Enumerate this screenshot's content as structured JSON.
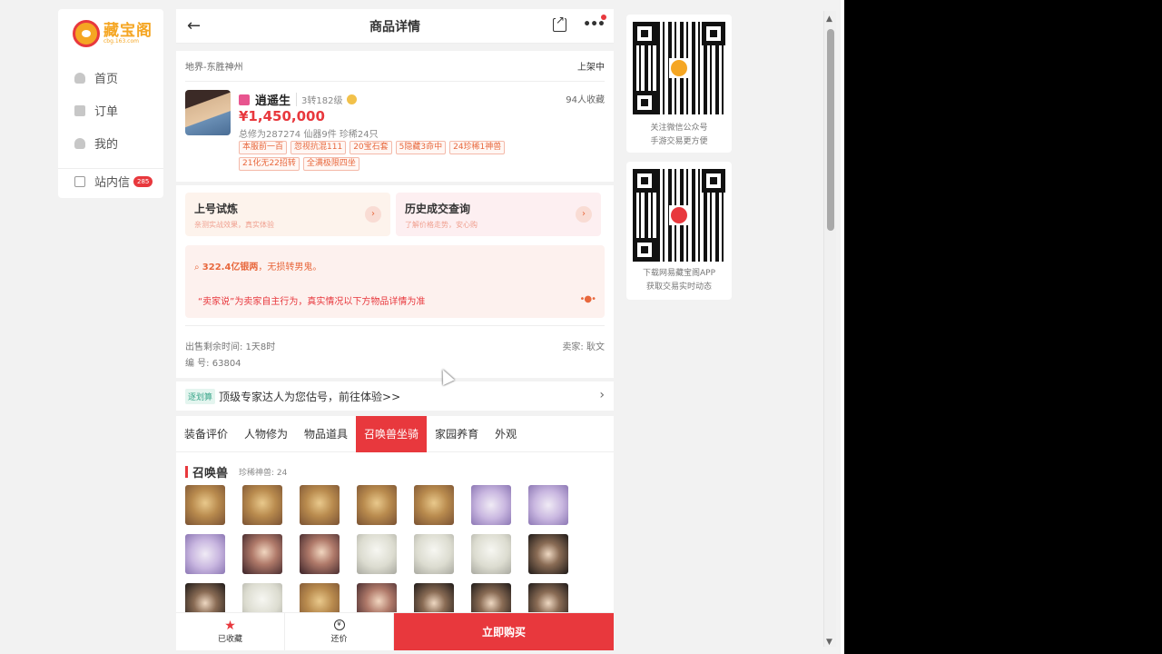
{
  "nav": {
    "logo_text": "藏宝阁",
    "logo_sub": "cbg.163.com",
    "items": [
      {
        "label": "首页"
      },
      {
        "label": "订单"
      },
      {
        "label": "我的"
      }
    ],
    "inbox": {
      "label": "站内信",
      "badge": "285"
    }
  },
  "header": {
    "title": "商品详情"
  },
  "listing": {
    "location": "地界-东胜神州",
    "status": "上架中",
    "role_name": "逍遥生",
    "role_level": "3转182级",
    "favorites": "94人收藏",
    "price": "¥1,450,000",
    "stats": "总修为287274  仙器9件  珍稀24只",
    "tags": [
      "本服前一百",
      "忽视抗混111",
      "20宝石套",
      "5隐藏3命中",
      "24珍稀1神兽",
      "21化无22招转",
      "全满极限四坐"
    ]
  },
  "features": {
    "trial": {
      "title": "上号试炼",
      "sub": "亲测实战效果，真实体验"
    },
    "history": {
      "title": "历史成交查询",
      "sub": "了解价格走势，安心购"
    },
    "go_icon": "chevron-right-icon"
  },
  "note": {
    "line1_bold": "322.4亿银两",
    "line1_rest": "，无损转男鬼。",
    "line2": "“卖家说”为卖家自主行为，真实情况以下方物品详情为准"
  },
  "meta": {
    "remaining": "出售剩余时间: 1天8时",
    "number": "编 号: 63804",
    "seller": "卖家: 耿文"
  },
  "plan": {
    "tag": "逐划算",
    "text": "顶级专家达人为您估号，前往体验>>"
  },
  "tabs": [
    "装备评价",
    "人物修为",
    "物品道具",
    "召唤兽坐骑",
    "家园养育",
    "外观"
  ],
  "active_tab": "召唤兽坐骑",
  "pets": {
    "title": "召唤兽",
    "sub": "珍稀神兽:  24",
    "grid": [
      [
        "gold",
        "gold",
        "gold",
        "gold",
        "gold",
        "lav",
        "lav"
      ],
      [
        "lav",
        "dark",
        "dark",
        "white",
        "white",
        "white",
        "black"
      ],
      [
        "black",
        "white",
        "gold",
        "dark",
        "black",
        "black",
        "black"
      ]
    ]
  },
  "footer": {
    "fav": "已收藏",
    "bargain": "还价",
    "buy": "立即购买"
  },
  "qr": {
    "wechat_caption_1": "关注微信公众号",
    "wechat_caption_2": "手游交易更方便",
    "app_caption_1": "下载网易藏宝阁APP",
    "app_caption_2": "获取交易实时动态"
  },
  "colors": {
    "accent": "#e8383d",
    "logo": "#f5a623"
  }
}
